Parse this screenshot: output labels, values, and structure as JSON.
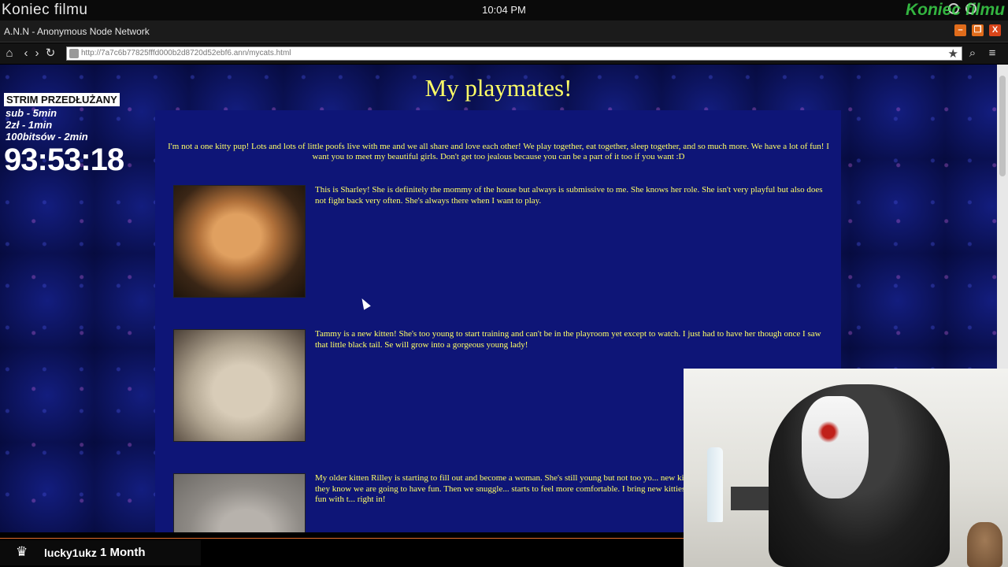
{
  "system_bar": {
    "left_text": "Koniec filmu",
    "clock": "10:04 PM",
    "right_text": "Koniec filmu"
  },
  "window": {
    "title": "A.N.N - Anonymous Node Network",
    "min": "–",
    "max": "❐",
    "close": "X"
  },
  "nav": {
    "home_icon": "⌂",
    "back_icon": "‹",
    "forward_icon": "›",
    "reload_icon": "↻",
    "url": "http://7a7c6b77825fffd000b2d8720d52ebf6.ann/mycats.html",
    "bookmark_icon": "★",
    "search_icon": "⌕",
    "menu_icon": "≡"
  },
  "page": {
    "heading": "My playmates!",
    "intro": "I'm not a one kitty pup! Lots and lots of little poofs live with me and we all share and love each other! We play together, eat together, sleep together, and so much more. We have a lot of fun! I want you to meet my beautiful girls. Don't get too jealous because you can be a part of it too if you want :D",
    "entries": [
      {
        "caption": "This is Sharley! She is definitely the mommy of the house but always is submissive to me. She knows her role. She isn't very playful but also does not fight back very often. She's always there when I want to play."
      },
      {
        "caption": "Tammy is a new kitten! She's too young to start training and can't be in the playroom yet except to watch. I just had to have her though once I saw that little black tail. Se will grow into a gorgeous young lady!"
      },
      {
        "caption": "My older kitten Rilley is starting to fill out and become a woman. She's still young but not too yo... new kittens into the playroom with toys so they know we are going to have fun. Then we snuggle... starts to feel more comfortable. I bring new kitties in to the playroom when I'm having fun with t... right in!"
      }
    ]
  },
  "stream_overlay": {
    "banner": "STRIM PRZEDŁUŻANY",
    "lines": [
      "sub - 5min",
      "2zł - 1min",
      "100bitsów - 2min"
    ],
    "timer": "93:53:18"
  },
  "sub_alert": {
    "crown_icon": "♛",
    "user": "lucky1ukz",
    "separator": "·",
    "months": "1 Month"
  },
  "colors": {
    "page_bg": "#0c1560",
    "panel_bg": "#0e1577",
    "text_yellow": "#ffff66",
    "accent_orange": "#e06c1b"
  }
}
